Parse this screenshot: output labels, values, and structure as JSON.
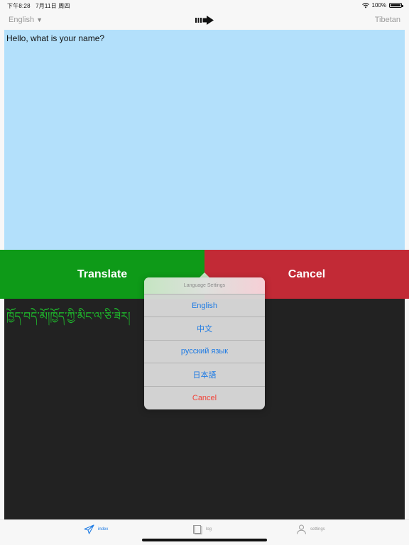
{
  "status_bar": {
    "time": "下午8:28",
    "date": "7月11日 周四",
    "battery": "100%"
  },
  "nav": {
    "source_language": "English",
    "dropdown_glyph": "▼",
    "target_language": "Tibetan",
    "swap_icon": "right-arrow-icon"
  },
  "input": {
    "text": "Hello, what is your name?",
    "background_color": "#b3e0fb"
  },
  "actions": {
    "translate_label": "Translate",
    "cancel_label": "Cancel",
    "translate_color": "#0e9a18",
    "cancel_color": "#c22a36"
  },
  "output": {
    "text": "ཁྱོད་བདེ་མོ།ཁྱོད་ཀྱི་མིང་ལ་ཅི་ཟེར།",
    "text_color": "#1fb82c",
    "background_color": "#222222"
  },
  "language_popover": {
    "title": "Language Settings",
    "options": [
      "English",
      "中文",
      "русский язык",
      "日本語"
    ],
    "cancel_label": "Cancel"
  },
  "tab_bar": {
    "tabs": [
      {
        "label": "index",
        "icon": "paper-plane-icon",
        "active": true
      },
      {
        "label": "log",
        "icon": "book-icon",
        "active": false
      },
      {
        "label": "settings",
        "icon": "person-icon",
        "active": false
      }
    ]
  }
}
